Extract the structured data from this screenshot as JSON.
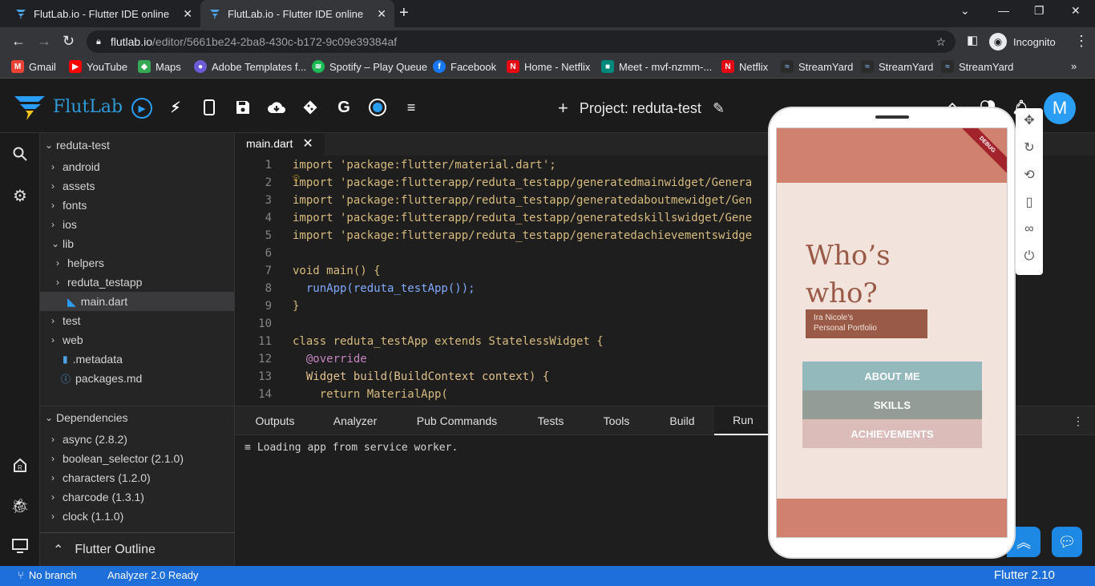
{
  "browser": {
    "tabs": [
      {
        "title": "FlutLab.io - Flutter IDE online",
        "active": false
      },
      {
        "title": "FlutLab.io - Flutter IDE online",
        "active": true
      }
    ],
    "url_host": "flutlab.io",
    "url_path": "/editor/5661be24-2ba8-430c-b172-9c09e39384af",
    "incognito_label": "Incognito",
    "bookmarks": [
      {
        "label": "Gmail",
        "color": "#ea4335",
        "glyph": "M"
      },
      {
        "label": "YouTube",
        "color": "#ff0000",
        "glyph": "▶"
      },
      {
        "label": "Maps",
        "color": "#34a853",
        "glyph": "◆"
      },
      {
        "label": "Adobe Templates f...",
        "color": "#6b5bd6",
        "glyph": "●"
      },
      {
        "label": "Spotify – Play Queue",
        "color": "#1db954",
        "glyph": "≋"
      },
      {
        "label": "Facebook",
        "color": "#1877f2",
        "glyph": "f"
      },
      {
        "label": "Home - Netflix",
        "color": "#e50914",
        "glyph": "N"
      },
      {
        "label": "Meet - mvf-nzmm-...",
        "color": "#00897b",
        "glyph": "■"
      },
      {
        "label": "Netflix",
        "color": "#e50914",
        "glyph": "N"
      },
      {
        "label": "StreamYard",
        "color": "#2b2b2b",
        "glyph": "≈"
      },
      {
        "label": "StreamYard",
        "color": "#2b2b2b",
        "glyph": "≈"
      },
      {
        "label": "StreamYard",
        "color": "#2b2b2b",
        "glyph": "≈"
      }
    ]
  },
  "app": {
    "name": "FlutLab",
    "project_label": "Project: reduta-test",
    "avatar_letter": "M",
    "accent": "#2f9bd8"
  },
  "tree": {
    "root": "reduta-test",
    "items": [
      "android",
      "assets",
      "fonts",
      "ios",
      "lib",
      "helpers",
      "reduta_testapp",
      "main.dart",
      "test",
      "web",
      ".metadata",
      "packages.md"
    ]
  },
  "dependencies": {
    "title": "Dependencies",
    "items": [
      "async (2.8.2)",
      "boolean_selector (2.1.0)",
      "characters (1.2.0)",
      "charcode (1.3.1)",
      "clock (1.1.0)"
    ]
  },
  "outline": {
    "title": "Flutter Outline"
  },
  "editor": {
    "tab": "main.dart",
    "line_numbers": [
      "1",
      "2",
      "3",
      "4",
      "5",
      "6",
      "7",
      "8",
      "9",
      "10",
      "11",
      "12",
      "13",
      "14"
    ],
    "lines": [
      "import 'package:flutter/material.dart';",
      "import 'package:flutterapp/reduta_testapp/generatedmainwidget/Genera",
      "import 'package:flutterapp/reduta_testapp/generatedaboutmewidget/Gen",
      "import 'package:flutterapp/reduta_testapp/generatedskillswidget/Gene",
      "import 'package:flutterapp/reduta_testapp/generatedachievementswidge",
      "",
      "void main() {",
      "  runApp(reduta_testApp());",
      "}",
      "",
      "class reduta_testApp extends StatelessWidget {",
      "  @override",
      "  Widget build(BuildContext context) {",
      "    return MaterialApp("
    ]
  },
  "bottom": {
    "tabs": [
      "Outputs",
      "Analyzer",
      "Pub Commands",
      "Tests",
      "Tools",
      "Build",
      "Run"
    ],
    "active_tab": "Run",
    "output": "Loading app from service worker."
  },
  "status": {
    "branch": "No branch",
    "analyzer": "Analyzer 2.0 Ready",
    "flutter": "Flutter 2.10"
  },
  "phone": {
    "debug": "DEBUG",
    "title": "Who’s who?",
    "subtitle_line1": "Ira Nicole’s",
    "subtitle_line2": "Personal Portfolio",
    "buttons": [
      {
        "label": "ABOUT ME",
        "color": "#93b9bd"
      },
      {
        "label": "SKILLS",
        "color": "#939c97"
      },
      {
        "label": "ACHIEVEMENTS",
        "color": "#dbbcb8"
      }
    ]
  }
}
